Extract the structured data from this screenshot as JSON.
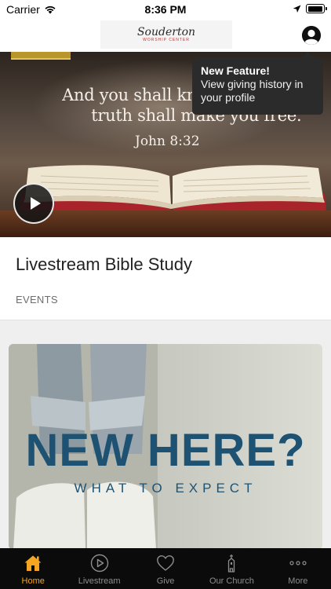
{
  "status_bar": {
    "carrier": "Carrier",
    "time": "8:36 PM",
    "battery_level": 0.95
  },
  "header": {
    "logo_script": "Souderton",
    "logo_sub": "WORSHIP CENTER"
  },
  "tooltip": {
    "title": "New Feature!",
    "body": "View giving history in your profile"
  },
  "hero": {
    "quote_line1": "And you shall know the",
    "quote_line2": "truth shall make you free.\"",
    "reference": "John 8:32"
  },
  "card": {
    "title": "Livestream Bible Study",
    "category": "EVENTS"
  },
  "promo": {
    "headline": "NEW HERE?",
    "subline": "WHAT TO EXPECT"
  },
  "tabs": [
    {
      "label": "Home",
      "icon": "home-icon",
      "active": true
    },
    {
      "label": "Livestream",
      "icon": "play-circle-icon",
      "active": false
    },
    {
      "label": "Give",
      "icon": "heart-icon",
      "active": false
    },
    {
      "label": "Our Church",
      "icon": "church-icon",
      "active": false
    },
    {
      "label": "More",
      "icon": "more-dots-icon",
      "active": false
    }
  ],
  "colors": {
    "accent": "#f4a623",
    "tabbar": "#0b0b0b",
    "promo_text": "#1e5272"
  }
}
